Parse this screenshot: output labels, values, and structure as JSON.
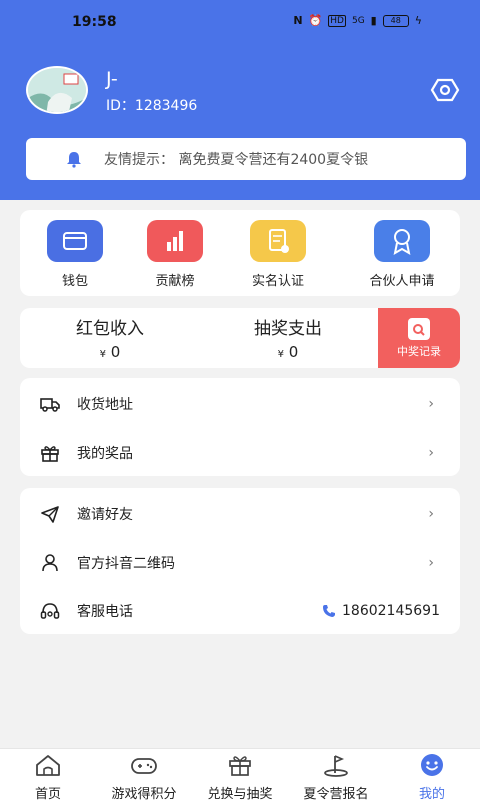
{
  "status_bar": {
    "time": "19:58",
    "network": "5G",
    "battery": "48"
  },
  "profile": {
    "name": "J-",
    "id_label": "ID：1283496"
  },
  "notice": {
    "text": "友情提示：  离免费夏令营还有2400夏令银"
  },
  "quick_actions": [
    {
      "label": "钱包",
      "icon": "wallet-icon",
      "color": "#4a6fe3"
    },
    {
      "label": "贡献榜",
      "icon": "bar-chart-icon",
      "color": "#f0595b"
    },
    {
      "label": "实名认证",
      "icon": "certificate-icon",
      "color": "#f5c84a"
    },
    {
      "label": "合伙人申请",
      "icon": "badge-icon",
      "color": "#4a7fe8"
    }
  ],
  "finance": {
    "red_packet_title": "红包收入",
    "red_packet_value": "0",
    "lottery_title": "抽奖支出",
    "lottery_value": "0",
    "currency": "¥",
    "prize_record_label": "中奖记录"
  },
  "menu_group1": [
    {
      "label": "收货地址",
      "icon": "truck-icon"
    },
    {
      "label": "我的奖品",
      "icon": "gift-icon"
    }
  ],
  "menu_group2": [
    {
      "label": "邀请好友",
      "icon": "send-icon"
    },
    {
      "label": "官方抖音二维码",
      "icon": "person-icon"
    },
    {
      "label": "客服电话",
      "icon": "headset-icon",
      "value": "18602145691"
    }
  ],
  "tabs": [
    {
      "label": "首页",
      "icon": "home-icon"
    },
    {
      "label": "游戏得积分",
      "icon": "gamepad-icon"
    },
    {
      "label": "兑换与抽奖",
      "icon": "gift-icon"
    },
    {
      "label": "夏令营报名",
      "icon": "camp-icon"
    },
    {
      "label": "我的",
      "icon": "smile-icon",
      "active": true
    }
  ],
  "colors": {
    "primary": "#4a73e8",
    "background": "#f2f2f2",
    "prize_red": "#f2605e"
  }
}
